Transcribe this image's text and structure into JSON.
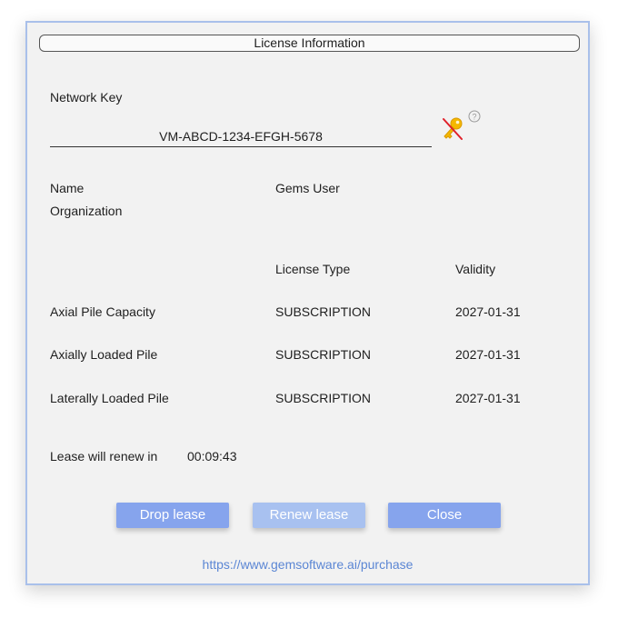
{
  "dialog": {
    "title": "License Information"
  },
  "network_key": {
    "label": "Network Key",
    "value": "VM-ABCD-1234-EFGH-5678",
    "icon": "key-disabled-icon",
    "help_icon": "help-icon",
    "icon_color": "#f5b800",
    "strike_color": "#e0202a"
  },
  "user": {
    "name_label": "Name",
    "name_value": "Gems User",
    "org_label": "Organization",
    "org_value": ""
  },
  "licenses": {
    "columns": [
      "",
      "License Type",
      "Validity"
    ],
    "rows": [
      {
        "product": "Axial Pile Capacity",
        "type": "SUBSCRIPTION",
        "validity": "2027-01-31"
      },
      {
        "product": "Axially Loaded Pile",
        "type": "SUBSCRIPTION",
        "validity": "2027-01-31"
      },
      {
        "product": "Laterally Loaded Pile",
        "type": "SUBSCRIPTION",
        "validity": "2027-01-31"
      }
    ]
  },
  "lease": {
    "label": "Lease will renew in",
    "countdown": "00:09:43"
  },
  "buttons": {
    "drop": "Drop lease",
    "renew": "Renew lease",
    "close": "Close"
  },
  "purchase_link": "https://www.gemsoftware.ai/purchase",
  "colors": {
    "accent": "#86a4ed",
    "accent_disabled": "#a8c1f0",
    "link": "#5b86d4",
    "border": "#a9c0ea"
  }
}
